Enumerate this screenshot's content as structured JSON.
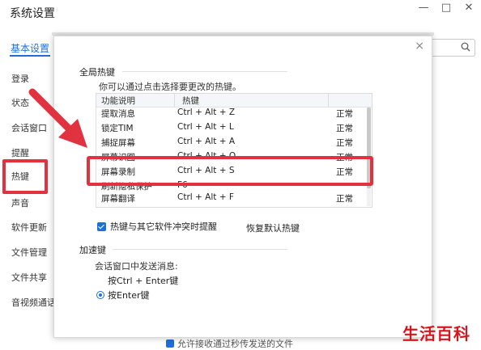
{
  "window": {
    "title": "系统设置",
    "tab": "基本设置",
    "controls": [
      "—",
      "□",
      "✕"
    ]
  },
  "sidebar": {
    "items": [
      {
        "label": "登录"
      },
      {
        "label": "状态"
      },
      {
        "label": "会话窗口"
      },
      {
        "label": "提醒"
      },
      {
        "label": "热键"
      },
      {
        "label": "声音"
      },
      {
        "label": "软件更新"
      },
      {
        "label": "文件管理"
      },
      {
        "label": "文件共享"
      },
      {
        "label": "音视频通话"
      }
    ]
  },
  "dialog": {
    "close": "×",
    "global_section": "全局热键",
    "hint": "你可以通过点击选择要更改的热键。",
    "table": {
      "headers": [
        "功能说明",
        "热键",
        ""
      ],
      "rows": [
        {
          "name": "提取消息",
          "key": "Ctrl + Alt + Z",
          "status": "正常"
        },
        {
          "name": "锁定TIM",
          "key": "Ctrl + Alt + L",
          "status": "正常"
        },
        {
          "name": "捕捉屏幕",
          "key": "Ctrl + Alt + A",
          "status": "正常"
        },
        {
          "name": "屏幕识图",
          "key": "Ctrl + Alt + O",
          "status": "正常"
        },
        {
          "name": "屏幕录制",
          "key": "Ctrl + Alt + S",
          "status": "正常"
        },
        {
          "name": "刷新隐私保护",
          "key": "F6",
          "status": ""
        },
        {
          "name": "屏幕翻译",
          "key": "Ctrl + Alt + F",
          "status": "正常"
        }
      ]
    },
    "conflict_checkbox": "热键与其它软件冲突时提醒",
    "restore_button": "恢复默认热键",
    "accel_section": "加速键",
    "send_label": "会话窗口中发送消息:",
    "options": [
      {
        "label": "按Ctrl + Enter键",
        "selected": false
      },
      {
        "label": "按Enter键",
        "selected": true
      }
    ]
  },
  "background_bottom": "允许接收通过秒传发送的文件",
  "watermark": "生活百科",
  "colors": {
    "accent": "#1e6fd9",
    "annotation_red": "#e0323f",
    "watermark_red": "#d8141c"
  }
}
